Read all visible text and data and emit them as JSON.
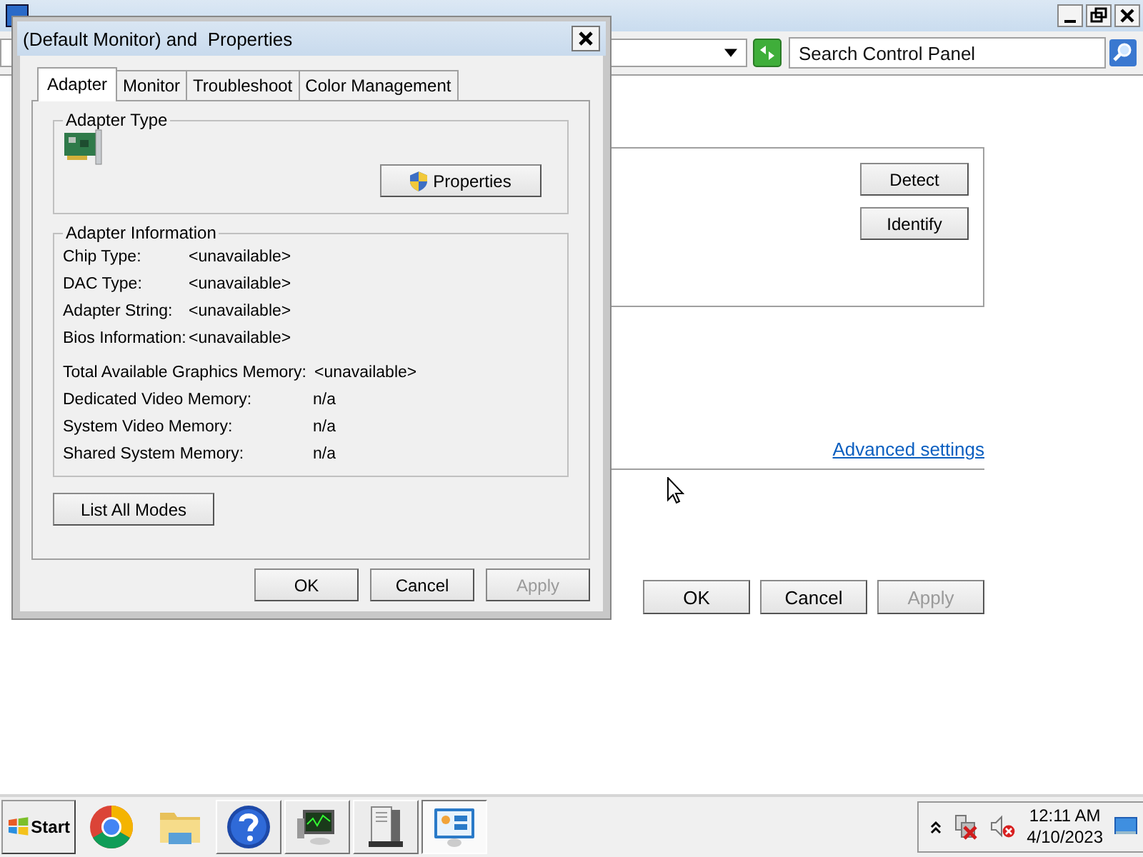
{
  "background_window": {
    "search": {
      "placeholder": "Search Control Panel"
    },
    "side_buttons": [
      {
        "label": "Detect"
      },
      {
        "label": "Identify"
      }
    ],
    "link": "Advanced settings",
    "buttons": [
      {
        "label": "OK",
        "disabled": false
      },
      {
        "label": "Cancel",
        "disabled": false
      },
      {
        "label": "Apply",
        "disabled": true
      }
    ]
  },
  "dialog": {
    "title": "(Default Monitor) and  Properties",
    "tabs": [
      {
        "label": "Adapter",
        "selected": true
      },
      {
        "label": "Monitor",
        "selected": false
      },
      {
        "label": "Troubleshoot",
        "selected": false
      },
      {
        "label": "Color Management",
        "selected": false
      }
    ],
    "adapter_type": {
      "heading": "Adapter Type",
      "button": "Properties"
    },
    "adapter_info": {
      "heading": "Adapter Information",
      "rows": [
        {
          "label": "Chip Type:",
          "value": "<unavailable>"
        },
        {
          "label": "DAC Type:",
          "value": "<unavailable>"
        },
        {
          "label": "Adapter String:",
          "value": "<unavailable>"
        },
        {
          "label": "Bios Information:",
          "value": "<unavailable>"
        }
      ],
      "memory_rows": [
        {
          "label": "Total Available Graphics Memory:",
          "value": "<unavailable>"
        },
        {
          "label": "Dedicated Video Memory:",
          "value": "n/a"
        },
        {
          "label": "System Video Memory:",
          "value": "n/a"
        },
        {
          "label": "Shared System Memory:",
          "value": "n/a"
        }
      ]
    },
    "list_button": "List All Modes",
    "buttons": [
      {
        "label": "OK",
        "disabled": false
      },
      {
        "label": "Cancel",
        "disabled": false
      },
      {
        "label": "Apply",
        "disabled": true
      }
    ]
  },
  "taskbar": {
    "start": "Start",
    "apps": [
      {
        "kind": "chrome",
        "selected": false
      },
      {
        "kind": "folder",
        "selected": false
      },
      {
        "kind": "help",
        "selected": false
      },
      {
        "kind": "monitor",
        "selected": false
      },
      {
        "kind": "server",
        "selected": false
      },
      {
        "kind": "display",
        "selected": true
      }
    ],
    "clock": {
      "time": "12:11 AM",
      "date": "4/10/2023"
    }
  }
}
